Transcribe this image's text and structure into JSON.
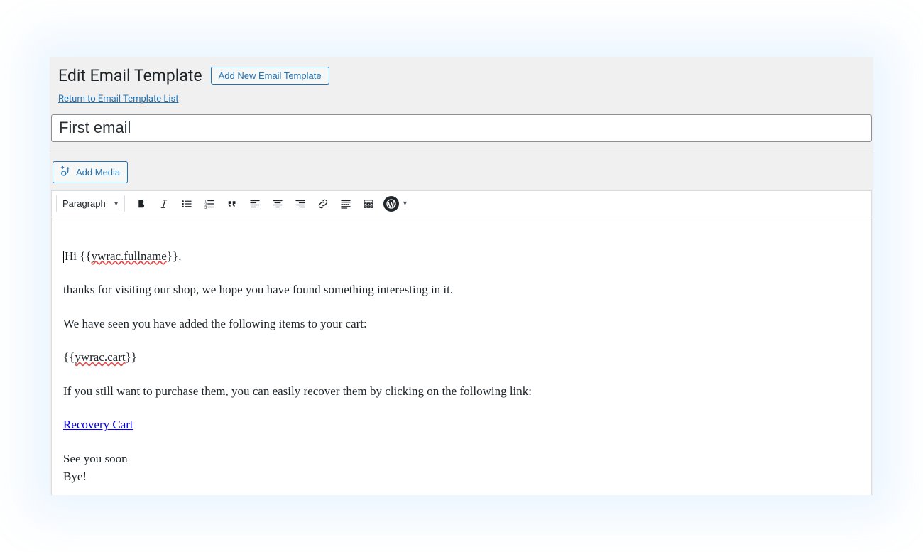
{
  "header": {
    "title": "Edit Email Template",
    "add_new_label": "Add New Email Template",
    "return_link": "Return to Email Template List"
  },
  "title_input": {
    "value": "First email"
  },
  "media": {
    "add_media_label": "Add Media"
  },
  "toolbar": {
    "format_select": "Paragraph",
    "buttons": {
      "bold": "Bold",
      "italic": "Italic",
      "ul": "Bulleted list",
      "ol": "Numbered list",
      "quote": "Blockquote",
      "align_left": "Align left",
      "align_center": "Align center",
      "align_right": "Align right",
      "link": "Insert/edit link",
      "more": "Insert Read More tag",
      "toolbar_toggle": "Toolbar toggle",
      "wp": "WordPress"
    }
  },
  "content": {
    "p1_pre": "Hi {{",
    "p1_err": "ywrac.fullname",
    "p1_post": "}},",
    "p2": "thanks for visiting our shop, we hope you have found something interesting in it.",
    "p3": "We have seen you have added the following items to your cart:",
    "p4_pre": "{{",
    "p4_err": "ywrac.cart",
    "p4_post": "}}",
    "p5": "If you still want to purchase them, you can easily recover them by clicking on the following link:",
    "link_text": "Recovery Cart",
    "p7": "See you soon",
    "p8": "Bye!"
  }
}
